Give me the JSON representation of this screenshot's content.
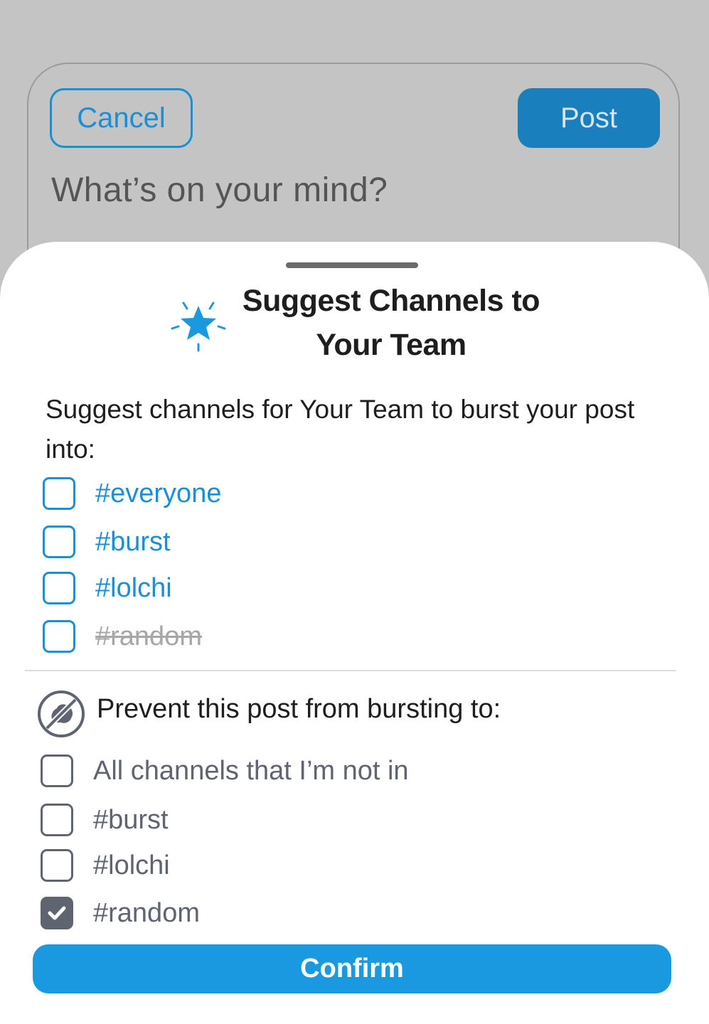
{
  "composer": {
    "cancel_label": "Cancel",
    "post_label": "Post",
    "placeholder": "What’s on your mind?"
  },
  "sheet": {
    "title": "Suggest Channels to Your Team",
    "suggest_description": "Suggest channels for Your Team to burst your post into:",
    "suggest_channels": [
      {
        "label": "#everyone",
        "checked": false,
        "disabled": false
      },
      {
        "label": "#burst",
        "checked": false,
        "disabled": false
      },
      {
        "label": "#lolchi",
        "checked": false,
        "disabled": false
      },
      {
        "label": "#random",
        "checked": false,
        "disabled": true
      }
    ],
    "prevent_heading": "Prevent this post from bursting to:",
    "prevent_options": [
      {
        "label": "All channels that I’m not in",
        "checked": false
      },
      {
        "label": "#burst",
        "checked": false
      },
      {
        "label": "#lolchi",
        "checked": false
      },
      {
        "label": "#random",
        "checked": true
      }
    ],
    "confirm_label": "Confirm"
  },
  "icons": {
    "title_icon": "sparkle-star-icon",
    "prevent_icon": "no-burst-icon",
    "check_icon": "checkmark-icon"
  },
  "colors": {
    "accent_blue": "#1a99e1",
    "post_button": "#1a7fbd",
    "muted_gray": "#5e6570",
    "overlay_background": "#c4c4c4"
  }
}
